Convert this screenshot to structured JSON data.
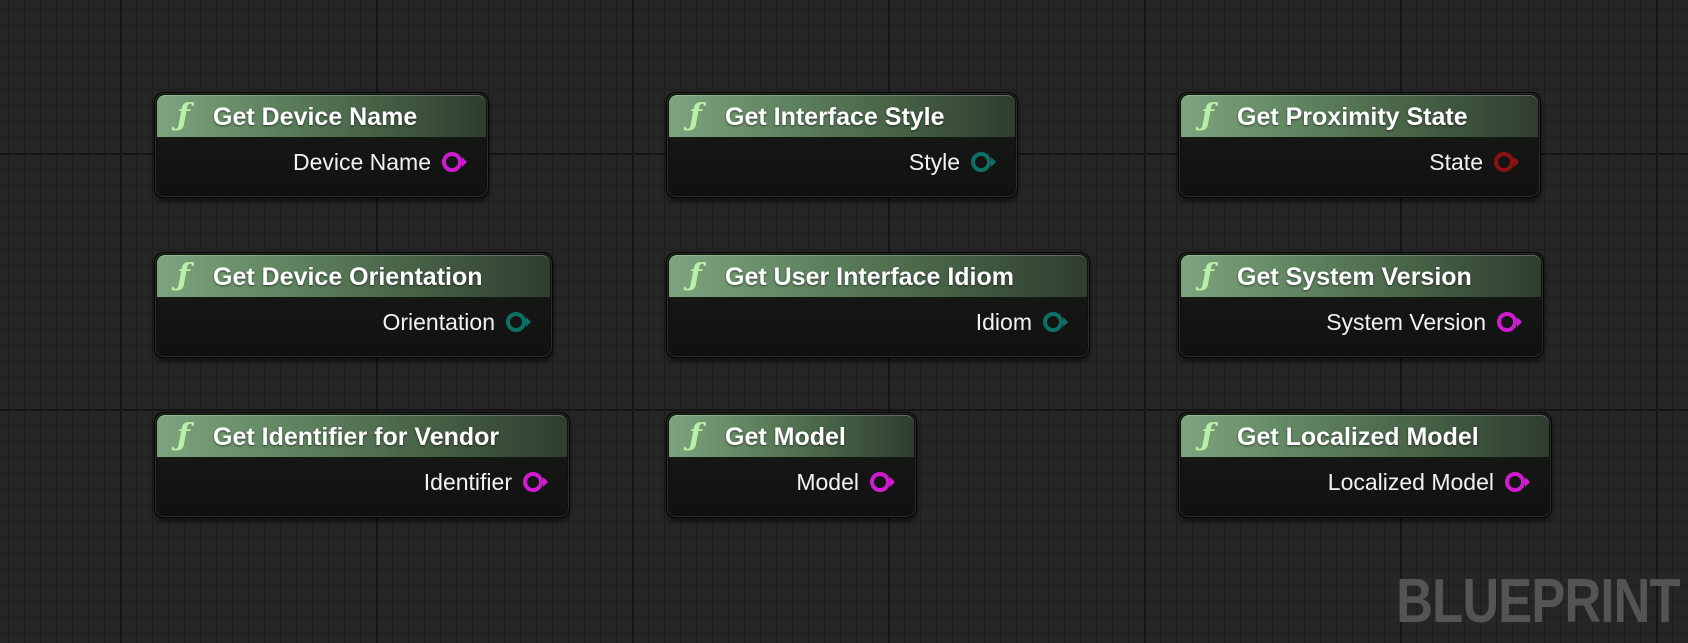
{
  "graph": {
    "nodes": [
      {
        "title": "Get Device Name",
        "output": {
          "label": "Device Name",
          "pin_color": "#d11bd1"
        }
      },
      {
        "title": "Get Interface Style",
        "output": {
          "label": "Style",
          "pin_color": "#0e6f67"
        }
      },
      {
        "title": "Get Proximity State",
        "output": {
          "label": "State",
          "pin_color": "#8a1212"
        }
      },
      {
        "title": "Get Device Orientation",
        "output": {
          "label": "Orientation",
          "pin_color": "#0e6f67"
        }
      },
      {
        "title": "Get User Interface Idiom",
        "output": {
          "label": "Idiom",
          "pin_color": "#0e6f67"
        }
      },
      {
        "title": "Get System Version",
        "output": {
          "label": "System Version",
          "pin_color": "#d11bd1"
        }
      },
      {
        "title": "Get Identifier for Vendor",
        "output": {
          "label": "Identifier",
          "pin_color": "#d11bd1"
        }
      },
      {
        "title": "Get Model",
        "output": {
          "label": "Model",
          "pin_color": "#d11bd1"
        }
      },
      {
        "title": "Get Localized Model",
        "output": {
          "label": "Localized Model",
          "pin_color": "#d11bd1"
        }
      }
    ]
  },
  "icons": {
    "function": "function-icon",
    "output_pin": "output-pin-icon"
  },
  "colors": {
    "header_green": "#5e825f",
    "string_pin": "#d11bd1",
    "enum_pin": "#0e6f67",
    "state_pin": "#8a1212"
  },
  "watermark": "BLUEPRINT"
}
